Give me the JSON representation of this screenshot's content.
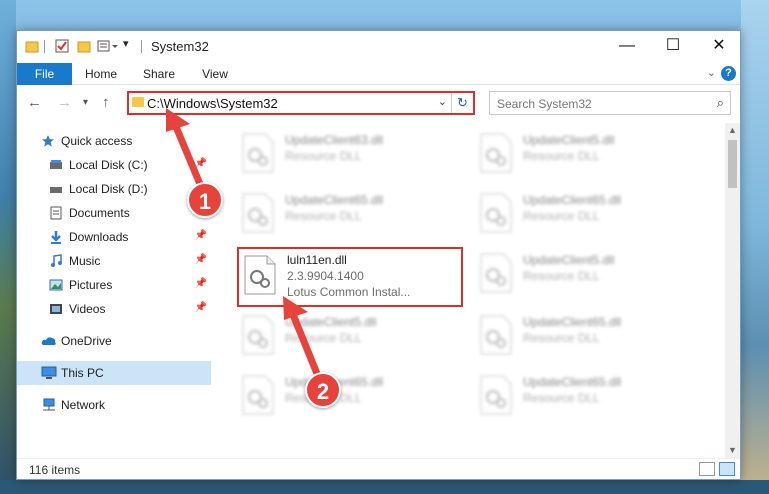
{
  "window": {
    "title": "System32",
    "controls": {
      "minimize": "—",
      "maximize": "☐",
      "close": "✕"
    }
  },
  "ribbon": {
    "tabs": [
      "File",
      "Home",
      "Share",
      "View"
    ],
    "help": "?"
  },
  "nav": {
    "address": "C:\\Windows\\System32",
    "search_placeholder": "Search System32"
  },
  "sidebar": {
    "items": [
      {
        "label": "Quick access",
        "icon": "star-icon"
      },
      {
        "label": "Local Disk (C:)",
        "icon": "drive-icon"
      },
      {
        "label": "Local Disk (D:)",
        "icon": "drive-icon"
      },
      {
        "label": "Documents",
        "icon": "documents-icon"
      },
      {
        "label": "Downloads",
        "icon": "download-icon"
      },
      {
        "label": "Music",
        "icon": "music-icon"
      },
      {
        "label": "Pictures",
        "icon": "pictures-icon"
      },
      {
        "label": "Videos",
        "icon": "videos-icon"
      },
      {
        "label": "OneDrive",
        "icon": "cloud-icon"
      },
      {
        "label": "This PC",
        "icon": "computer-icon"
      },
      {
        "label": "Network",
        "icon": "network-icon"
      }
    ]
  },
  "files": [
    {
      "name": "UpdateClient63.dll",
      "sub": "Resource DLL",
      "blurred": true
    },
    {
      "name": "UpdateClient5.dll",
      "sub": "Resource DLL",
      "blurred": true
    },
    {
      "name": "UpdateClient65.dll",
      "sub": "Resource DLL",
      "blurred": true
    },
    {
      "name": "UpdateClient65.dll",
      "sub": "Resource DLL",
      "blurred": true
    },
    {
      "name": "luln11en.dll",
      "sub": "2.3.9904.1400",
      "sub2": "Lotus Common Instal...",
      "blurred": false
    },
    {
      "name": "UpdateClient5.dll",
      "sub": "Resource DLL",
      "blurred": true
    },
    {
      "name": "UpdateClient5.dll",
      "sub": "Resource DLL",
      "blurred": true
    },
    {
      "name": "UpdateClient65.dll",
      "sub": "Resource DLL",
      "blurred": true
    },
    {
      "name": "UpdateClient65.dll",
      "sub": "Resource DLL",
      "blurred": true
    },
    {
      "name": "UpdateClient65.dll",
      "sub": "Resource DLL",
      "blurred": true
    }
  ],
  "status": {
    "count": "116 items"
  },
  "callouts": {
    "one": "1",
    "two": "2"
  },
  "colors": {
    "accent": "#1979ca",
    "highlight": "#d9302c",
    "callout": "#e5433b"
  }
}
